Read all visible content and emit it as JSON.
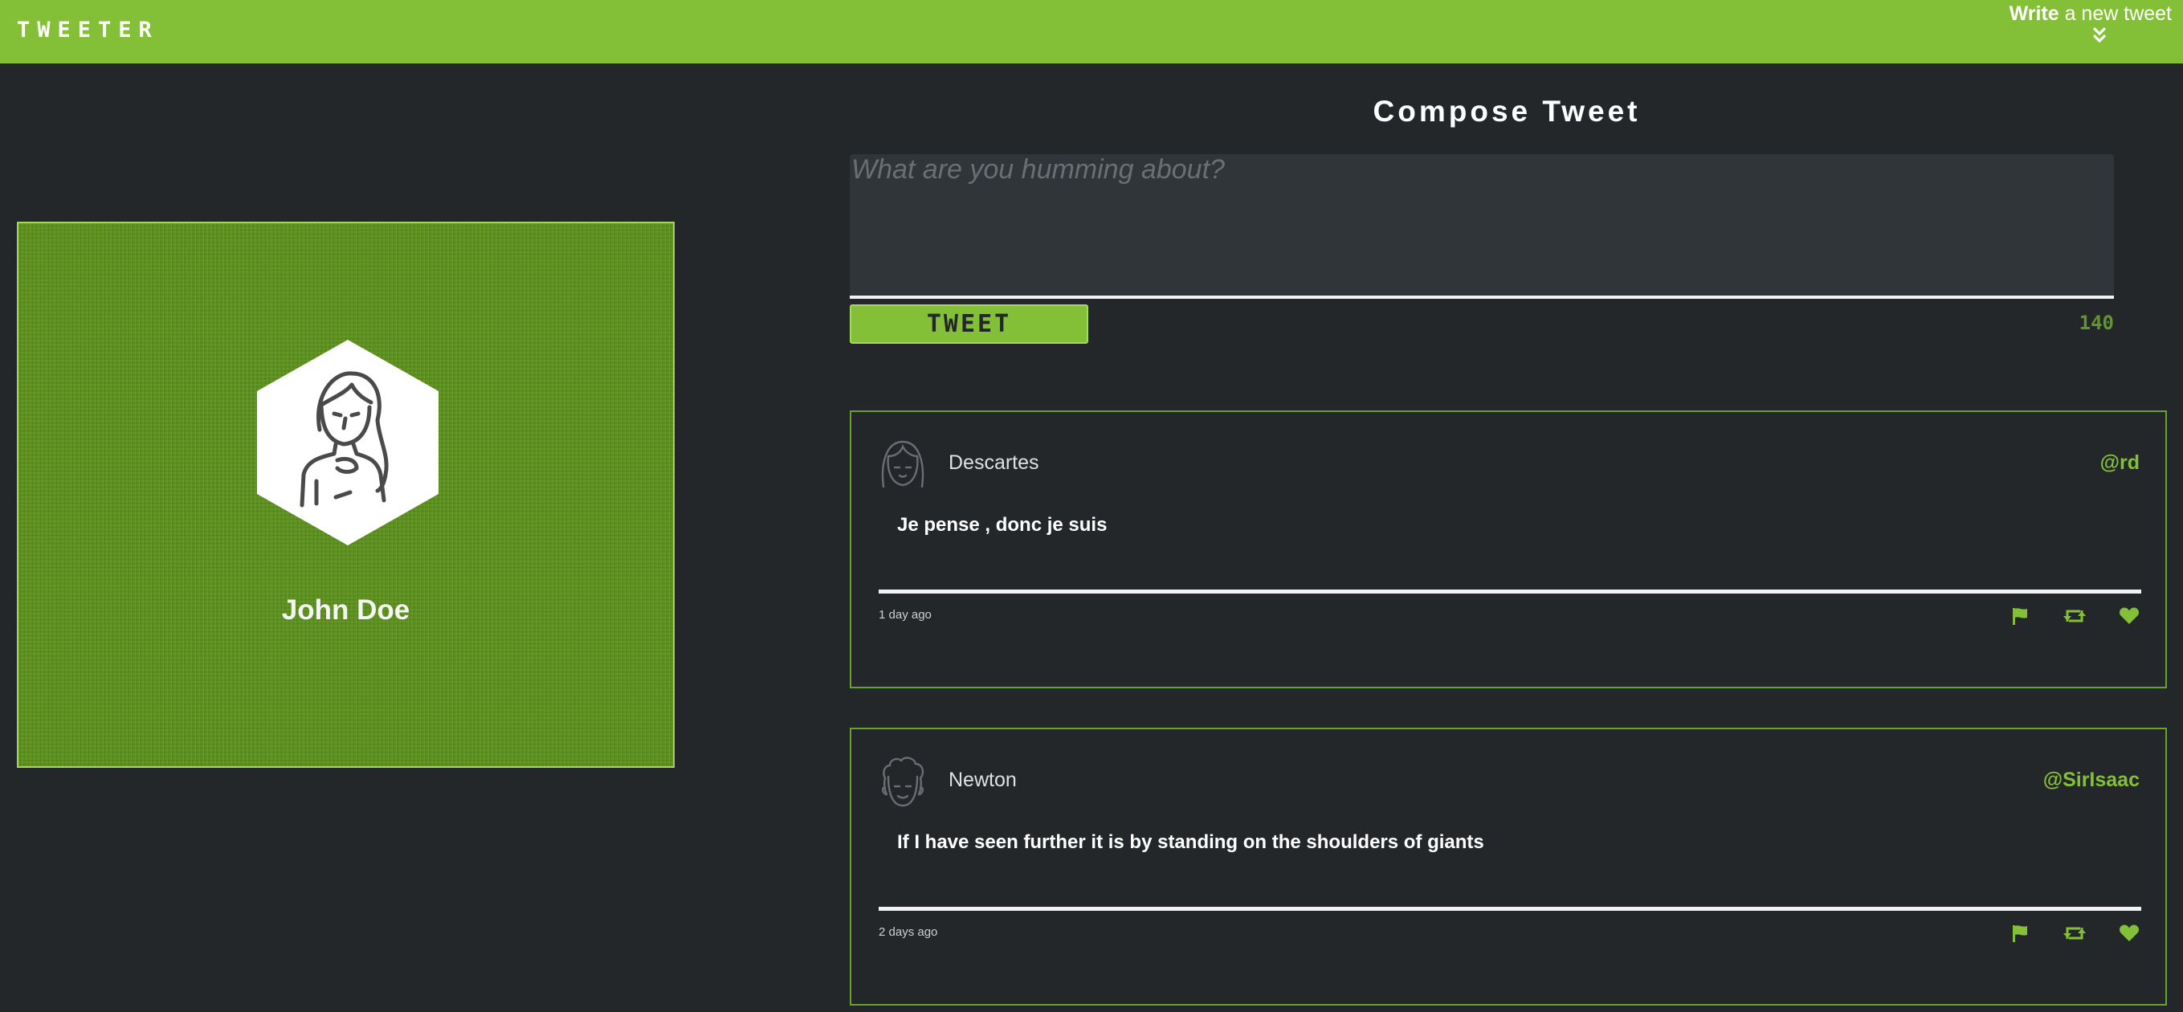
{
  "nav": {
    "brand": "TWEETER",
    "write_bold": "Write",
    "write_rest": " a new tweet",
    "toggle_icon": "double-chevron-down-icon"
  },
  "profile": {
    "name": "John Doe",
    "avatar_icon": "woman-avatar-icon"
  },
  "compose": {
    "title": "Compose Tweet",
    "placeholder": "What are you humming about?",
    "value": "",
    "button_label": "TWEET",
    "counter": "140"
  },
  "tweets": [
    {
      "name": "Descartes",
      "handle": "@rd",
      "text": "Je pense , donc je suis",
      "time": "1 day ago",
      "avatar_icon": "girl-avatar-icon"
    },
    {
      "name": "Newton",
      "handle": "@SirIsaac",
      "text": "If I have seen further it is by standing on the shoulders of giants",
      "time": "2 days ago",
      "avatar_icon": "curly-man-avatar-icon"
    }
  ],
  "actions": {
    "flag_icon": "flag-icon",
    "retweet_icon": "retweet-icon",
    "like_icon": "heart-icon"
  },
  "colors": {
    "accent": "#84c037",
    "background": "#23272a",
    "profile_bg": "#5e931d"
  }
}
